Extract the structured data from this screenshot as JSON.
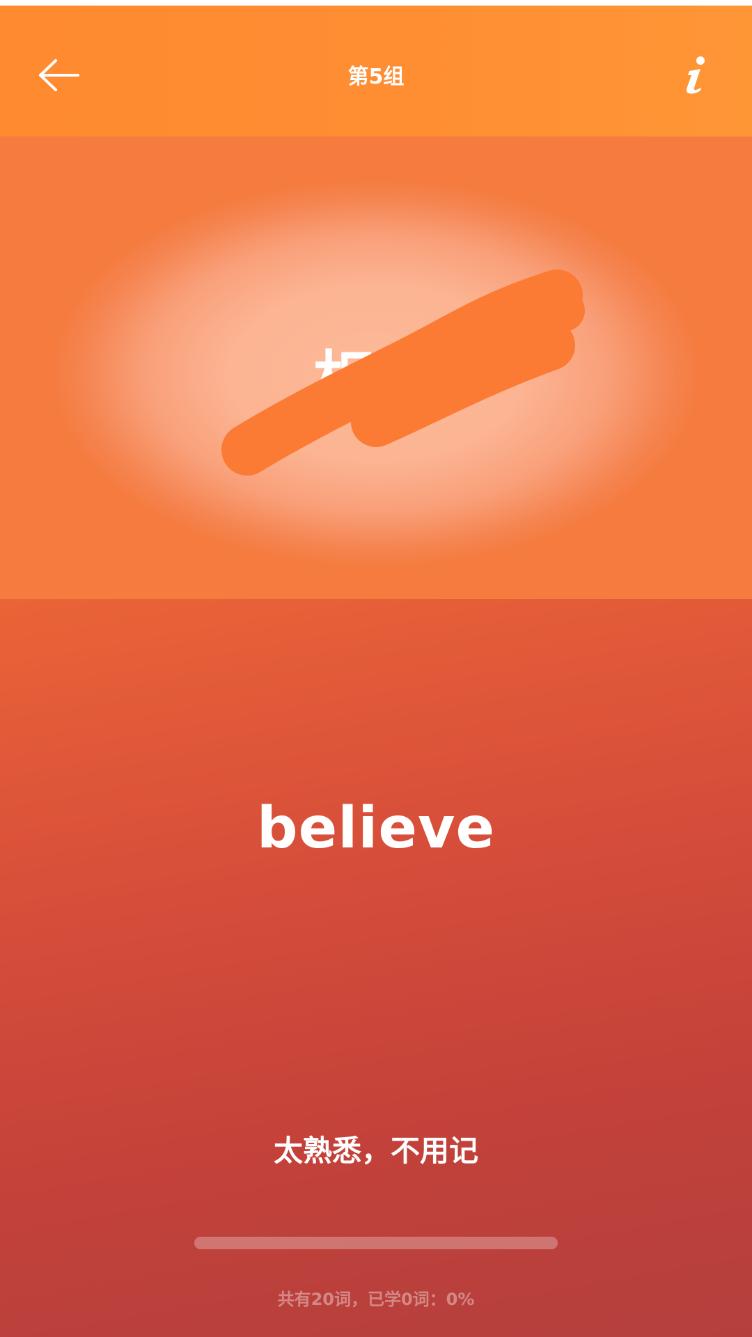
{
  "header": {
    "title": "第5组",
    "back_icon": "arrow-left-icon",
    "info_icon": "info-icon"
  },
  "card": {
    "chinese_word": "相信"
  },
  "word": {
    "english": "believe"
  },
  "actions": {
    "too_familiar_label": "太熟悉，不用记"
  },
  "progress": {
    "fraction": 0,
    "text": "共有20词，已学0词：0%"
  },
  "colors": {
    "header": "#ff8d32",
    "scribble": "#fb7b35",
    "text": "#ffffff"
  }
}
